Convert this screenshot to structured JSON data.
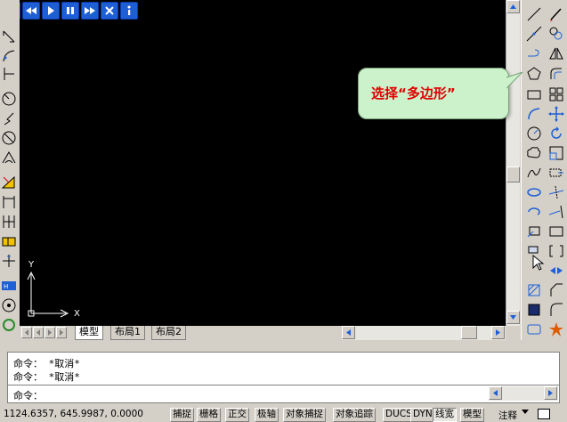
{
  "playback": {
    "buttons": [
      "first-icon",
      "rewind-icon",
      "play-icon",
      "pause-icon",
      "fast-forward-icon",
      "close-icon",
      "info-icon"
    ]
  },
  "tabs": {
    "items": [
      {
        "label": "模型",
        "active": true
      },
      {
        "label": "布局1",
        "active": false
      },
      {
        "label": "布局2",
        "active": false
      }
    ]
  },
  "callout": {
    "text": "选择“多边形”"
  },
  "ucs": {
    "x_label": "X",
    "y_label": "Y"
  },
  "command": {
    "history": [
      "命令： *取消*",
      "命令： *取消*"
    ],
    "prompt": "命令："
  },
  "status": {
    "coords": "1124.6357, 645.9987, 0.0000",
    "toggles": [
      {
        "label": "捕捉",
        "on": false
      },
      {
        "label": "栅格",
        "on": false
      },
      {
        "label": "正交",
        "on": false
      },
      {
        "label": "极轴",
        "on": false
      },
      {
        "label": "对象捕捉",
        "on": false
      },
      {
        "label": "对象追踪",
        "on": false
      },
      {
        "label": "DUCS",
        "on": false
      },
      {
        "label": "DYN",
        "on": false
      },
      {
        "label": "线宽",
        "on": true
      },
      {
        "label": "模型",
        "on": false
      }
    ],
    "annotation": "注释"
  },
  "colors": {
    "canvas": "#000000",
    "callout_bg": "#ccf2cc",
    "callout_text": "#e00000",
    "playback_btn": "#1f5fd6"
  }
}
